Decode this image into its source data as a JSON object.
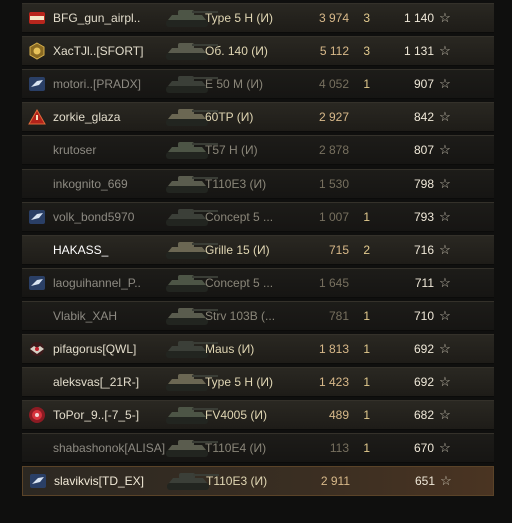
{
  "rows": [
    {
      "player": "BFG_gun_airpl..",
      "badge": "lebwa-clan-emblem",
      "tank": "Type 5 H (И)",
      "damage": "3 974",
      "kills": "3",
      "xp": "1 140",
      "style": ""
    },
    {
      "player": "XacTJl..[SFORT]",
      "badge": "gold-hex-clan-emblem",
      "tank": "Об. 140 (И)",
      "damage": "5 112",
      "kills": "3",
      "xp": "1 131",
      "style": ""
    },
    {
      "player": "motori..[PRADX]",
      "badge": "blue-bird-clan-emblem",
      "tank": "E 50 M (И)",
      "damage": "4 052",
      "kills": "1",
      "xp": "907",
      "style": "dim"
    },
    {
      "player": "zorkie_glaza",
      "badge": "red-triangle-clan-emblem",
      "tank": "60TP (И)",
      "damage": "2 927",
      "kills": "",
      "xp": "842",
      "style": ""
    },
    {
      "player": "krutoser",
      "badge": "",
      "tank": "T57 H (И)",
      "damage": "2 878",
      "kills": "",
      "xp": "807",
      "style": "dim"
    },
    {
      "player": "inkognito_669",
      "badge": "",
      "tank": "T110E3 (И)",
      "damage": "1 530",
      "kills": "",
      "xp": "798",
      "style": "dim"
    },
    {
      "player": "volk_bond5970",
      "badge": "blue-bird-clan-emblem",
      "tank": "Concept 5 ...",
      "damage": "1 007",
      "kills": "1",
      "xp": "793",
      "style": "dim"
    },
    {
      "player": "HAKASS_",
      "badge": "",
      "tank": "Grille 15 (И)",
      "damage": "715",
      "kills": "2",
      "xp": "716",
      "style": "bright"
    },
    {
      "player": "laoguihannel_P..",
      "badge": "blue-bird-clan-emblem",
      "tank": "Concept 5 ...",
      "damage": "1 645",
      "kills": "",
      "xp": "711",
      "style": "dim"
    },
    {
      "player": "Vlabik_XAH",
      "badge": "",
      "tank": "Strv 103B (...",
      "damage": "781",
      "kills": "1",
      "xp": "710",
      "style": "dim"
    },
    {
      "player": "pifagorus[QWL]",
      "badge": "winged-skull-clan-emblem",
      "tank": "Maus (И)",
      "damage": "1 813",
      "kills": "1",
      "xp": "692",
      "style": ""
    },
    {
      "player": "aleksvas[_21R-]",
      "badge": "",
      "tank": "Type 5 H (И)",
      "damage": "1 423",
      "kills": "1",
      "xp": "692",
      "style": ""
    },
    {
      "player": "ToPor_9..[-7_5-]",
      "badge": "red-circle-clan-emblem",
      "tank": "FV4005 (И)",
      "damage": "489",
      "kills": "1",
      "xp": "682",
      "style": ""
    },
    {
      "player": "shabashonok[ALISA]",
      "badge": "",
      "tank": "T110E4 (И)",
      "damage": "113",
      "kills": "1",
      "xp": "670",
      "style": "dim"
    },
    {
      "player": "slavikvis[TD_EX]",
      "badge": "blue-bird-clan-emblem",
      "tank": "T110E3 (И)",
      "damage": "2 911",
      "kills": "",
      "xp": "651",
      "style": "highlight"
    }
  ],
  "star_glyph": "☆"
}
